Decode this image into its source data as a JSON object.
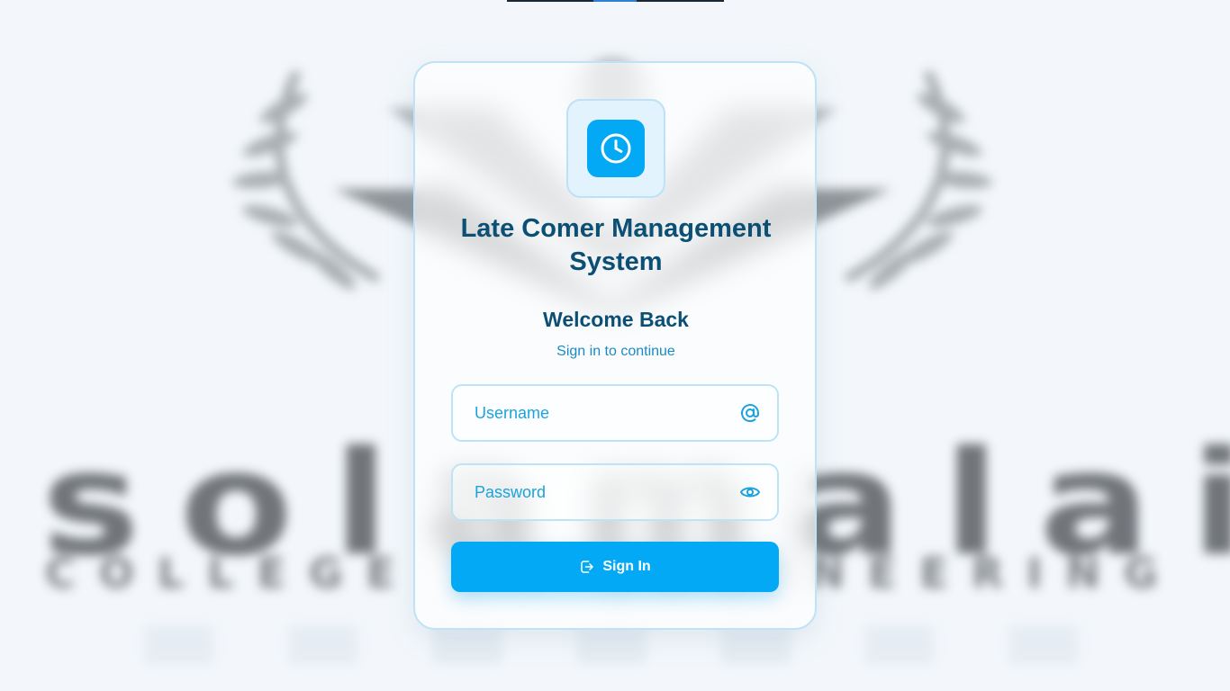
{
  "app": {
    "title": "Late Comer Management System",
    "logo_icon": "clock-icon"
  },
  "welcome": {
    "heading": "Welcome Back",
    "subtitle": "Sign in to continue"
  },
  "form": {
    "username": {
      "value": "",
      "placeholder": "Username",
      "icon": "at-sign-icon"
    },
    "password": {
      "value": "",
      "placeholder": "Password",
      "icon": "eye-icon"
    },
    "submit": {
      "label": "Sign In",
      "icon": "sign-in-icon"
    }
  },
  "background": {
    "word": "solamalai",
    "subtitle": "COLLEGE OF ENGINEERING"
  },
  "colors": {
    "primary": "#03a9f4",
    "heading": "#0b4f74",
    "subtitle": "#1a8ac4",
    "card_border": "#bfe3f5",
    "page_background": "#f3f7fb"
  }
}
